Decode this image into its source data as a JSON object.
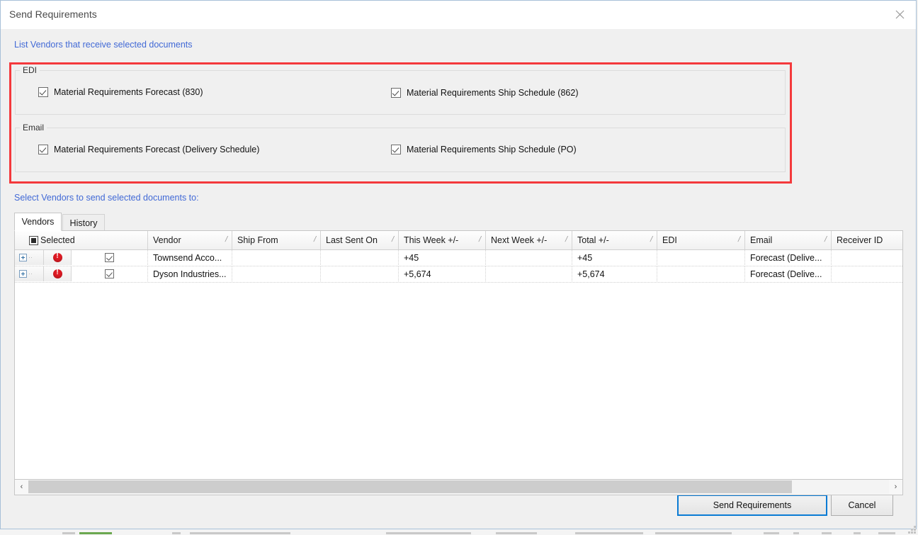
{
  "window": {
    "title": "Send Requirements",
    "close_icon": "close-icon"
  },
  "labels": {
    "list_vendors": "List Vendors that receive selected documents",
    "select_vendors": "Select Vendors to send selected documents to:"
  },
  "highlight": {
    "color": "#f4393c"
  },
  "groups": [
    {
      "title": "EDI",
      "options": [
        {
          "label": "Material Requirements Forecast (830)",
          "checked": true
        },
        {
          "label": "Material Requirements Ship Schedule (862)",
          "checked": true
        }
      ]
    },
    {
      "title": "Email",
      "options": [
        {
          "label": "Material Requirements Forecast (Delivery Schedule)",
          "checked": true
        },
        {
          "label": "Material Requirements Ship Schedule (PO)",
          "checked": true
        }
      ]
    }
  ],
  "tabs": [
    {
      "label": "Vendors",
      "active": true
    },
    {
      "label": "History",
      "active": false
    }
  ],
  "grid": {
    "columns": [
      {
        "label": "Selected",
        "sortable": false
      },
      {
        "label": "Vendor",
        "sortable": true
      },
      {
        "label": "Ship From",
        "sortable": true
      },
      {
        "label": "Last Sent On",
        "sortable": true
      },
      {
        "label": "This Week +/-",
        "sortable": true
      },
      {
        "label": "Next Week +/-",
        "sortable": true
      },
      {
        "label": "Total +/-",
        "sortable": true
      },
      {
        "label": "EDI",
        "sortable": true
      },
      {
        "label": "Email",
        "sortable": true
      },
      {
        "label": "Receiver ID",
        "sortable": false
      }
    ],
    "sort_glyph": "/",
    "rows": [
      {
        "expander": "expand-icon",
        "status": "error-icon",
        "selected": true,
        "vendor": "Townsend Acco...",
        "ship_from": "",
        "last_sent_on": "",
        "this_week": "+45",
        "next_week": "",
        "total": "+45",
        "edi": "",
        "email": "Forecast (Delive...",
        "receiver_id": ""
      },
      {
        "expander": "expand-icon",
        "status": "error-icon",
        "selected": true,
        "vendor": "Dyson Industries...",
        "ship_from": "",
        "last_sent_on": "",
        "this_week": "+5,674",
        "next_week": "",
        "total": "+5,674",
        "edi": "",
        "email": "Forecast (Delive...",
        "receiver_id": ""
      }
    ]
  },
  "scrollbar": {
    "left_arrow": "‹",
    "right_arrow": "›"
  },
  "footer": {
    "send_label": "Send Requirements",
    "cancel_label": "Cancel"
  }
}
